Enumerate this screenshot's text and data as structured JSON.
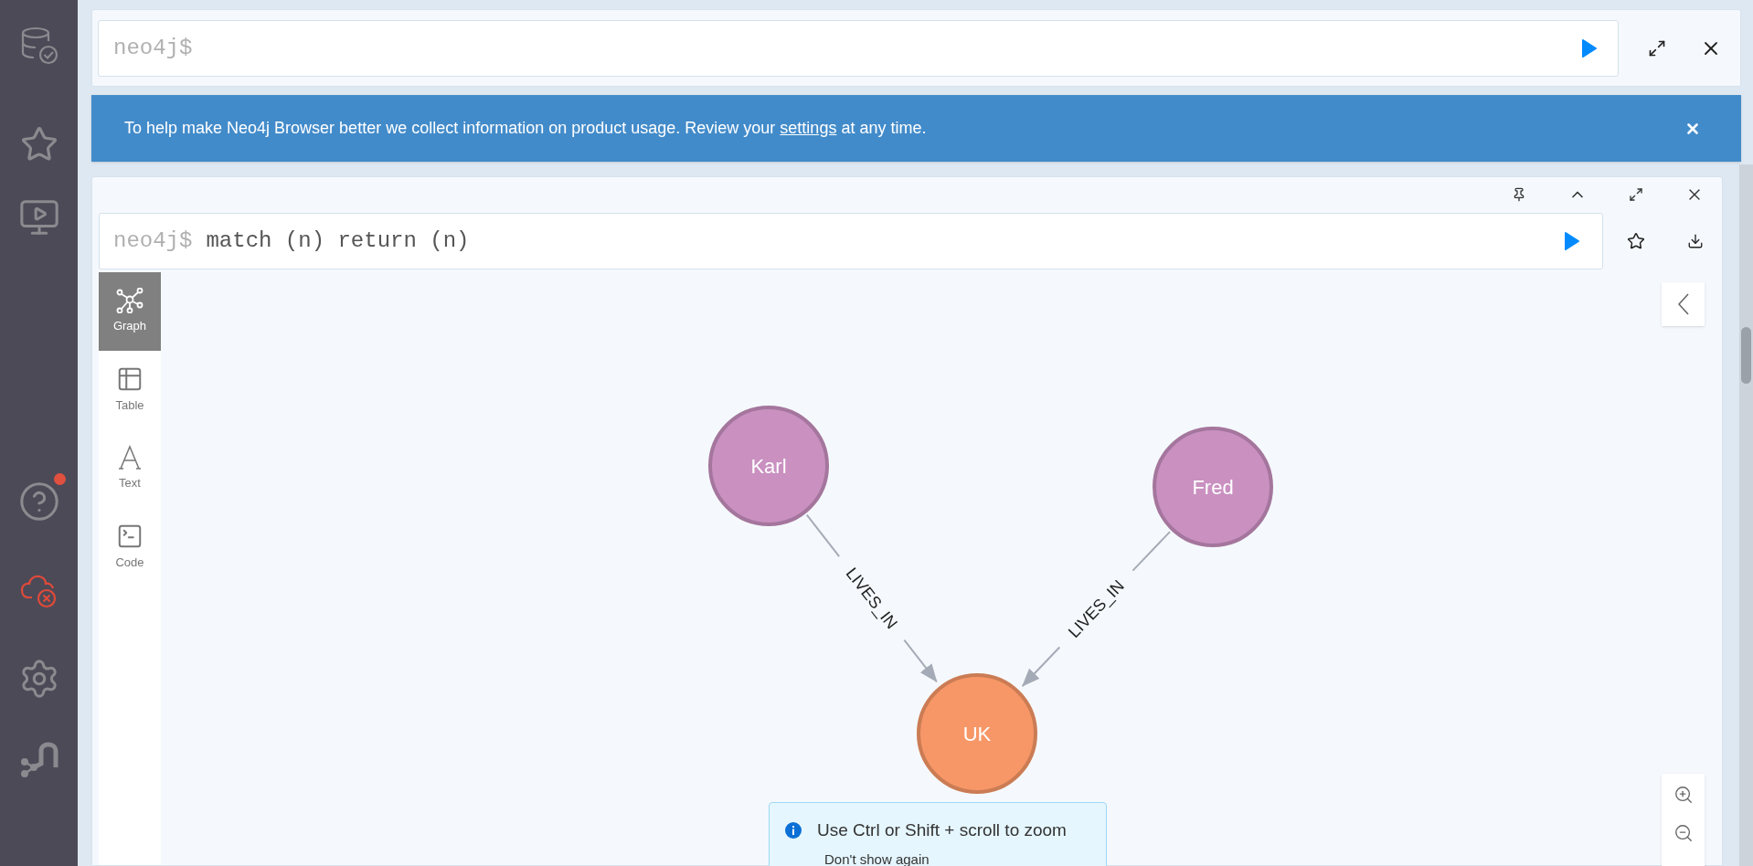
{
  "sidebar": {
    "help_notification": true,
    "connection_error": true
  },
  "top_editor": {
    "prompt": "neo4j$"
  },
  "banner": {
    "text_before": "To help make Neo4j Browser better we collect information on product usage. Review your ",
    "link": "settings",
    "text_after": " at any time."
  },
  "frame": {
    "prompt": "neo4j$",
    "query": "match (n) return (n)",
    "views": [
      {
        "label": "Graph",
        "kind": "graph",
        "selected": true
      },
      {
        "label": "Table",
        "kind": "table",
        "selected": false
      },
      {
        "label": "Text",
        "kind": "text",
        "selected": false
      },
      {
        "label": "Code",
        "kind": "code",
        "selected": false
      }
    ],
    "nodes": [
      {
        "label": "Karl",
        "color": "#c990c0"
      },
      {
        "label": "Fred",
        "color": "#c990c0"
      },
      {
        "label": "UK",
        "color": "#f79767"
      }
    ],
    "relationships": [
      {
        "type": "LIVES_IN"
      },
      {
        "type": "LIVES_IN"
      }
    ],
    "hint": {
      "message": "Use Ctrl or Shift + scroll to zoom",
      "action": "Don't show again"
    }
  }
}
